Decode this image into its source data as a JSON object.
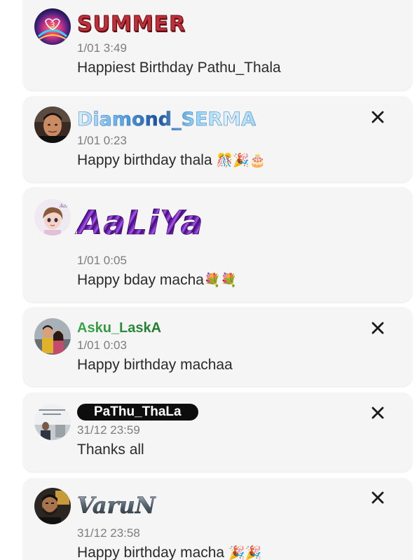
{
  "comments": [
    {
      "name": "SUMMER",
      "time": "1/01 3:49",
      "message": "Happiest Birthday Pathu_Thala",
      "emoji": "",
      "avatar_icon": "summer-3-avatar",
      "has_close": false
    },
    {
      "name": "Diamond_SERMA",
      "time": "1/01 0:23",
      "message": "Happy birthday thala ",
      "emoji": "🎊🎉🎂",
      "avatar_icon": "man-portrait-avatar",
      "has_close": true
    },
    {
      "name": "AaLiYa",
      "time": "1/01 0:05",
      "message": "Happy bday macha",
      "emoji": "💐💐",
      "avatar_icon": "cartoon-girl-avatar",
      "has_close": false
    },
    {
      "name": "Asku_LaskA",
      "time": "1/01 0:03",
      "message": "Happy birthday machaa",
      "emoji": "",
      "avatar_icon": "couple-photo-avatar",
      "has_close": true
    },
    {
      "name": "PaThu_ThaLa",
      "time": "31/12 23:59",
      "message": "Thanks all",
      "emoji": "",
      "avatar_icon": "person-photo-avatar",
      "has_close": true
    },
    {
      "name": "VaruN",
      "time": "31/12 23:58",
      "message": "Happy birthday macha ",
      "emoji": "🎉🎉",
      "avatar_icon": "man-beard-avatar",
      "has_close": true
    }
  ],
  "colors": {
    "card_background": "#f5f5f5",
    "timestamp": "#7d7d7d",
    "message_text": "#2a2a2a",
    "summer_name": "#c0303a",
    "asku_name": "#2e8f3b",
    "pathu_badge": "#0d0d0d"
  },
  "icons": {
    "close": "close-icon"
  }
}
